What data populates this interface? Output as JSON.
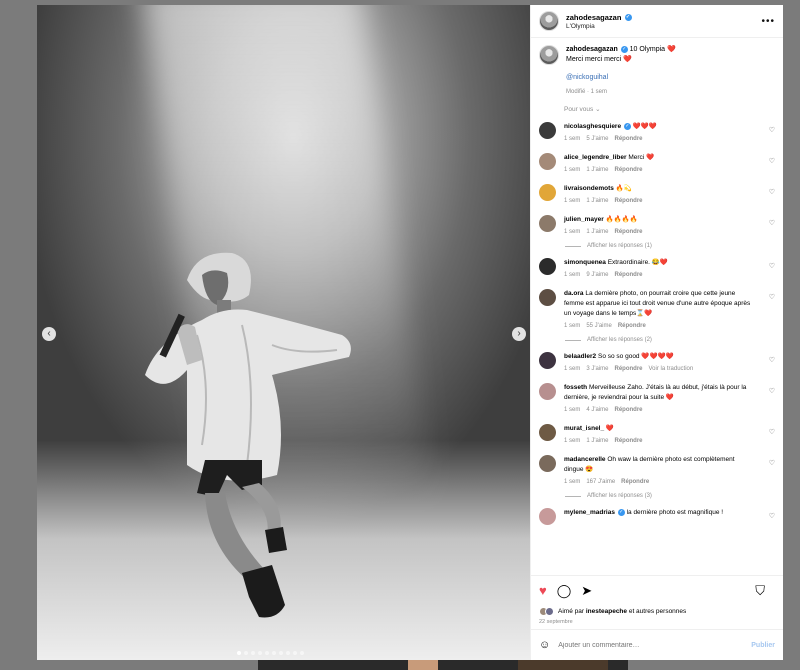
{
  "post": {
    "username": "zahodesagazan",
    "location": "L'Olympia",
    "caption_line1": "10 Olympia ❤️",
    "caption_line2": "Merci merci merci ❤️",
    "mention": "@nickoguihal",
    "caption_meta": "Modifié · 1 sem",
    "for_you": "Pour vous ⌄"
  },
  "icons": {
    "more": "more-options-icon",
    "prev": "chevron-left-icon",
    "next": "chevron-right-icon",
    "like": "heart-icon",
    "comment": "comment-bubble-icon",
    "share": "paper-plane-icon",
    "save": "bookmark-icon",
    "emoji": "smiley-icon"
  },
  "comments": [
    {
      "user": "nicolasghesquiere",
      "verified": true,
      "text": "❤️❤️❤️",
      "time": "1 sem",
      "likes": "5 J'aime",
      "reply": "Répondre",
      "replies": "",
      "color": "#3b3b3b"
    },
    {
      "user": "alice_legendre_liber",
      "verified": false,
      "text": "Merci ❤️",
      "time": "1 sem",
      "likes": "1 J'aime",
      "reply": "Répondre",
      "replies": "",
      "color": "#a48a78"
    },
    {
      "user": "livraisondemots",
      "verified": false,
      "text": "🔥💫",
      "time": "1 sem",
      "likes": "1 J'aime",
      "reply": "Répondre",
      "replies": "",
      "color": "#e1a638"
    },
    {
      "user": "julien_mayer",
      "verified": false,
      "text": "🔥🔥🔥🔥",
      "time": "1 sem",
      "likes": "1 J'aime",
      "reply": "Répondre",
      "replies": "Afficher les réponses (1)",
      "color": "#8c7a6a"
    },
    {
      "user": "simonquenea",
      "verified": false,
      "text": "Extraordinaire. 😂❤️",
      "time": "1 sem",
      "likes": "9 J'aime",
      "reply": "Répondre",
      "replies": "",
      "color": "#2b2b2b"
    },
    {
      "user": "da.ora",
      "verified": false,
      "text": "La dernière photo, on pourrait croire que cette jeune femme est apparue ici tout droit venue d'une autre époque après un voyage dans le temps⌛❤️",
      "time": "1 sem",
      "likes": "55 J'aime",
      "reply": "Répondre",
      "replies": "Afficher les réponses (2)",
      "color": "#5d4e43"
    },
    {
      "user": "belaadler2",
      "verified": false,
      "text": "So so so good ❤️❤️❤️❤️",
      "time": "1 sem",
      "likes": "3 J'aime",
      "reply": "Répondre",
      "extra": "Voir la traduction",
      "replies": "",
      "color": "#3d3340"
    },
    {
      "user": "fosseth",
      "verified": false,
      "text": "Merveilleuse Zaho. J'étais là au début, j'étais là pour la dernière, je reviendrai pour la suite ❤️",
      "time": "1 sem",
      "likes": "4 J'aime",
      "reply": "Répondre",
      "replies": "",
      "color": "#b78f8f"
    },
    {
      "user": "murat_isnel_",
      "verified": false,
      "text": "❤️",
      "time": "1 sem",
      "likes": "1 J'aime",
      "reply": "Répondre",
      "replies": "",
      "color": "#6e5a44"
    },
    {
      "user": "madancerelle",
      "verified": false,
      "text": "Oh waw la dernière photo est complètement dingue 😍",
      "time": "1 sem",
      "likes": "167 J'aime",
      "reply": "Répondre",
      "replies": "Afficher les réponses (3)",
      "color": "#7a6a5c"
    },
    {
      "user": "mylene_madrias",
      "verified": true,
      "text": "la dernière photo est magnifique !",
      "time": "",
      "likes": "",
      "reply": "",
      "replies": "",
      "color": "#c79a9a"
    }
  ],
  "footer": {
    "liked_prefix": "Aimé par",
    "liked_user": "inesteapeche",
    "liked_suffix": "et autres personnes",
    "date": "22 septembre",
    "comment_placeholder": "Ajouter un commentaire…",
    "post_label": "Publier"
  },
  "carousel": {
    "count": 10,
    "active": 0
  }
}
